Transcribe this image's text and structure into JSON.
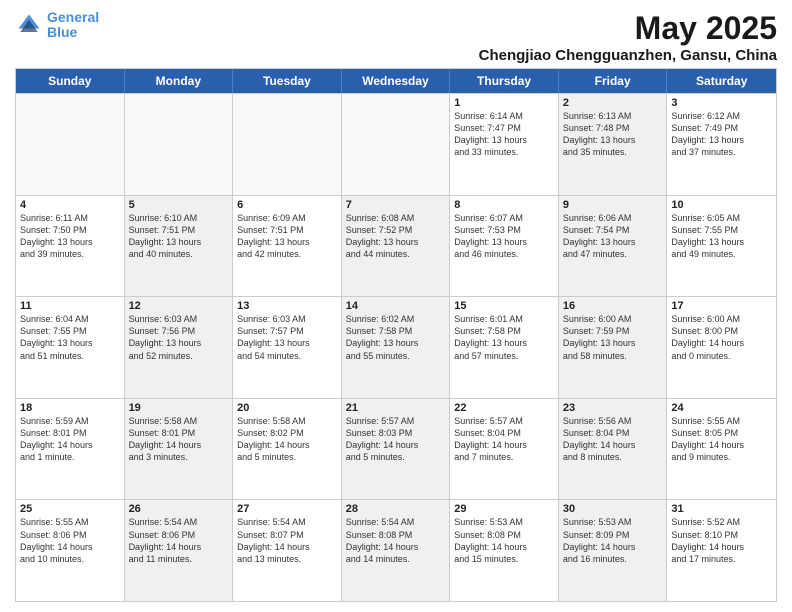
{
  "header": {
    "logo_line1": "General",
    "logo_line2": "Blue",
    "month_title": "May 2025",
    "location": "Chengjiao Chengguanzhen, Gansu, China"
  },
  "weekdays": [
    "Sunday",
    "Monday",
    "Tuesday",
    "Wednesday",
    "Thursday",
    "Friday",
    "Saturday"
  ],
  "rows": [
    [
      {
        "day": "",
        "info": "",
        "shaded": false,
        "empty": true
      },
      {
        "day": "",
        "info": "",
        "shaded": false,
        "empty": true
      },
      {
        "day": "",
        "info": "",
        "shaded": false,
        "empty": true
      },
      {
        "day": "",
        "info": "",
        "shaded": false,
        "empty": true
      },
      {
        "day": "1",
        "info": "Sunrise: 6:14 AM\nSunset: 7:47 PM\nDaylight: 13 hours\nand 33 minutes.",
        "shaded": false,
        "empty": false
      },
      {
        "day": "2",
        "info": "Sunrise: 6:13 AM\nSunset: 7:48 PM\nDaylight: 13 hours\nand 35 minutes.",
        "shaded": true,
        "empty": false
      },
      {
        "day": "3",
        "info": "Sunrise: 6:12 AM\nSunset: 7:49 PM\nDaylight: 13 hours\nand 37 minutes.",
        "shaded": false,
        "empty": false
      }
    ],
    [
      {
        "day": "4",
        "info": "Sunrise: 6:11 AM\nSunset: 7:50 PM\nDaylight: 13 hours\nand 39 minutes.",
        "shaded": false,
        "empty": false
      },
      {
        "day": "5",
        "info": "Sunrise: 6:10 AM\nSunset: 7:51 PM\nDaylight: 13 hours\nand 40 minutes.",
        "shaded": true,
        "empty": false
      },
      {
        "day": "6",
        "info": "Sunrise: 6:09 AM\nSunset: 7:51 PM\nDaylight: 13 hours\nand 42 minutes.",
        "shaded": false,
        "empty": false
      },
      {
        "day": "7",
        "info": "Sunrise: 6:08 AM\nSunset: 7:52 PM\nDaylight: 13 hours\nand 44 minutes.",
        "shaded": true,
        "empty": false
      },
      {
        "day": "8",
        "info": "Sunrise: 6:07 AM\nSunset: 7:53 PM\nDaylight: 13 hours\nand 46 minutes.",
        "shaded": false,
        "empty": false
      },
      {
        "day": "9",
        "info": "Sunrise: 6:06 AM\nSunset: 7:54 PM\nDaylight: 13 hours\nand 47 minutes.",
        "shaded": true,
        "empty": false
      },
      {
        "day": "10",
        "info": "Sunrise: 6:05 AM\nSunset: 7:55 PM\nDaylight: 13 hours\nand 49 minutes.",
        "shaded": false,
        "empty": false
      }
    ],
    [
      {
        "day": "11",
        "info": "Sunrise: 6:04 AM\nSunset: 7:55 PM\nDaylight: 13 hours\nand 51 minutes.",
        "shaded": false,
        "empty": false
      },
      {
        "day": "12",
        "info": "Sunrise: 6:03 AM\nSunset: 7:56 PM\nDaylight: 13 hours\nand 52 minutes.",
        "shaded": true,
        "empty": false
      },
      {
        "day": "13",
        "info": "Sunrise: 6:03 AM\nSunset: 7:57 PM\nDaylight: 13 hours\nand 54 minutes.",
        "shaded": false,
        "empty": false
      },
      {
        "day": "14",
        "info": "Sunrise: 6:02 AM\nSunset: 7:58 PM\nDaylight: 13 hours\nand 55 minutes.",
        "shaded": true,
        "empty": false
      },
      {
        "day": "15",
        "info": "Sunrise: 6:01 AM\nSunset: 7:58 PM\nDaylight: 13 hours\nand 57 minutes.",
        "shaded": false,
        "empty": false
      },
      {
        "day": "16",
        "info": "Sunrise: 6:00 AM\nSunset: 7:59 PM\nDaylight: 13 hours\nand 58 minutes.",
        "shaded": true,
        "empty": false
      },
      {
        "day": "17",
        "info": "Sunrise: 6:00 AM\nSunset: 8:00 PM\nDaylight: 14 hours\nand 0 minutes.",
        "shaded": false,
        "empty": false
      }
    ],
    [
      {
        "day": "18",
        "info": "Sunrise: 5:59 AM\nSunset: 8:01 PM\nDaylight: 14 hours\nand 1 minute.",
        "shaded": false,
        "empty": false
      },
      {
        "day": "19",
        "info": "Sunrise: 5:58 AM\nSunset: 8:01 PM\nDaylight: 14 hours\nand 3 minutes.",
        "shaded": true,
        "empty": false
      },
      {
        "day": "20",
        "info": "Sunrise: 5:58 AM\nSunset: 8:02 PM\nDaylight: 14 hours\nand 5 minutes.",
        "shaded": false,
        "empty": false
      },
      {
        "day": "21",
        "info": "Sunrise: 5:57 AM\nSunset: 8:03 PM\nDaylight: 14 hours\nand 5 minutes.",
        "shaded": true,
        "empty": false
      },
      {
        "day": "22",
        "info": "Sunrise: 5:57 AM\nSunset: 8:04 PM\nDaylight: 14 hours\nand 7 minutes.",
        "shaded": false,
        "empty": false
      },
      {
        "day": "23",
        "info": "Sunrise: 5:56 AM\nSunset: 8:04 PM\nDaylight: 14 hours\nand 8 minutes.",
        "shaded": true,
        "empty": false
      },
      {
        "day": "24",
        "info": "Sunrise: 5:55 AM\nSunset: 8:05 PM\nDaylight: 14 hours\nand 9 minutes.",
        "shaded": false,
        "empty": false
      }
    ],
    [
      {
        "day": "25",
        "info": "Sunrise: 5:55 AM\nSunset: 8:06 PM\nDaylight: 14 hours\nand 10 minutes.",
        "shaded": false,
        "empty": false
      },
      {
        "day": "26",
        "info": "Sunrise: 5:54 AM\nSunset: 8:06 PM\nDaylight: 14 hours\nand 11 minutes.",
        "shaded": true,
        "empty": false
      },
      {
        "day": "27",
        "info": "Sunrise: 5:54 AM\nSunset: 8:07 PM\nDaylight: 14 hours\nand 13 minutes.",
        "shaded": false,
        "empty": false
      },
      {
        "day": "28",
        "info": "Sunrise: 5:54 AM\nSunset: 8:08 PM\nDaylight: 14 hours\nand 14 minutes.",
        "shaded": true,
        "empty": false
      },
      {
        "day": "29",
        "info": "Sunrise: 5:53 AM\nSunset: 8:08 PM\nDaylight: 14 hours\nand 15 minutes.",
        "shaded": false,
        "empty": false
      },
      {
        "day": "30",
        "info": "Sunrise: 5:53 AM\nSunset: 8:09 PM\nDaylight: 14 hours\nand 16 minutes.",
        "shaded": true,
        "empty": false
      },
      {
        "day": "31",
        "info": "Sunrise: 5:52 AM\nSunset: 8:10 PM\nDaylight: 14 hours\nand 17 minutes.",
        "shaded": false,
        "empty": false
      }
    ]
  ]
}
